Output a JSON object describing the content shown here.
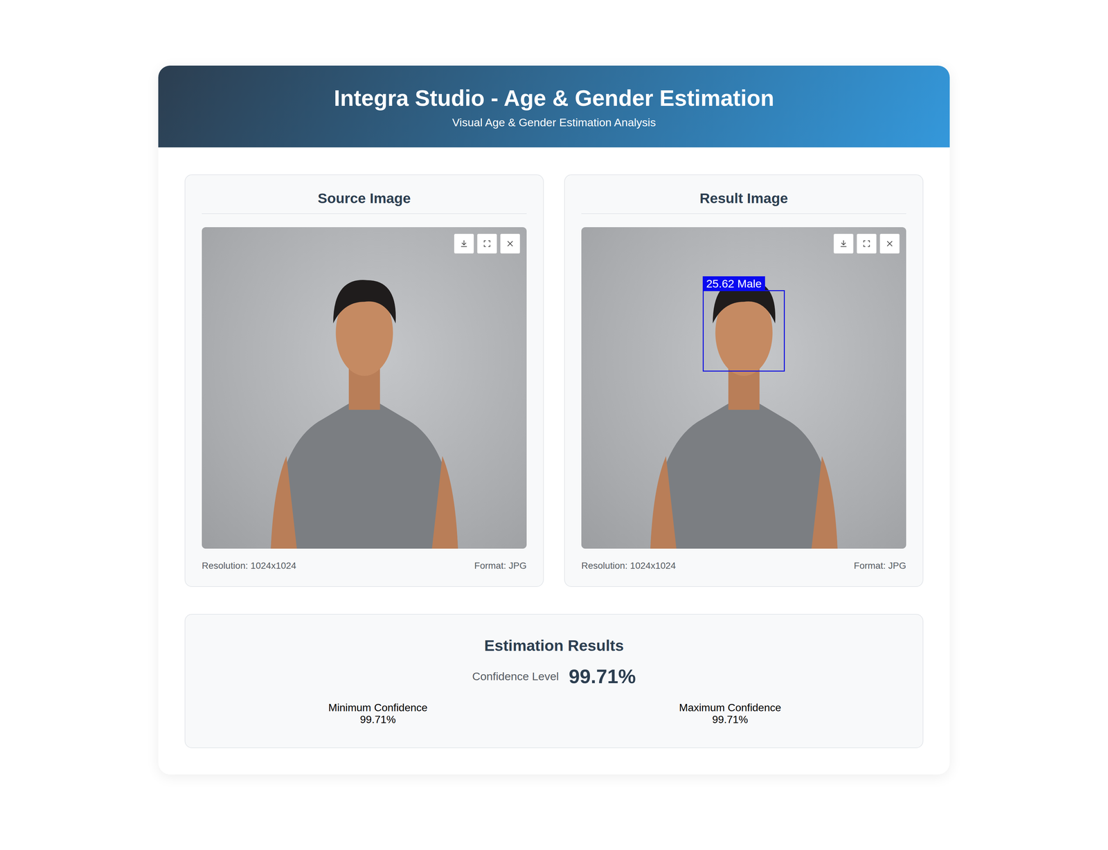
{
  "header": {
    "title": "Integra Studio - Age & Gender Estimation",
    "subtitle": "Visual Age & Gender Estimation Analysis"
  },
  "panels": [
    {
      "title": "Source Image",
      "resolution": "Resolution: 1024x1024",
      "format": "Format: JPG",
      "detection": null
    },
    {
      "title": "Result Image",
      "resolution": "Resolution: 1024x1024",
      "format": "Format: JPG",
      "detection": {
        "label": "25.62 Male"
      }
    }
  ],
  "results": {
    "title": "Estimation Results",
    "confidence_label": "Confidence Level",
    "confidence": "99.71%",
    "stats": [
      {
        "label": "Minimum Confidence",
        "value": "99.71%"
      },
      {
        "label": "Maximum Confidence",
        "value": "99.71%"
      }
    ]
  }
}
